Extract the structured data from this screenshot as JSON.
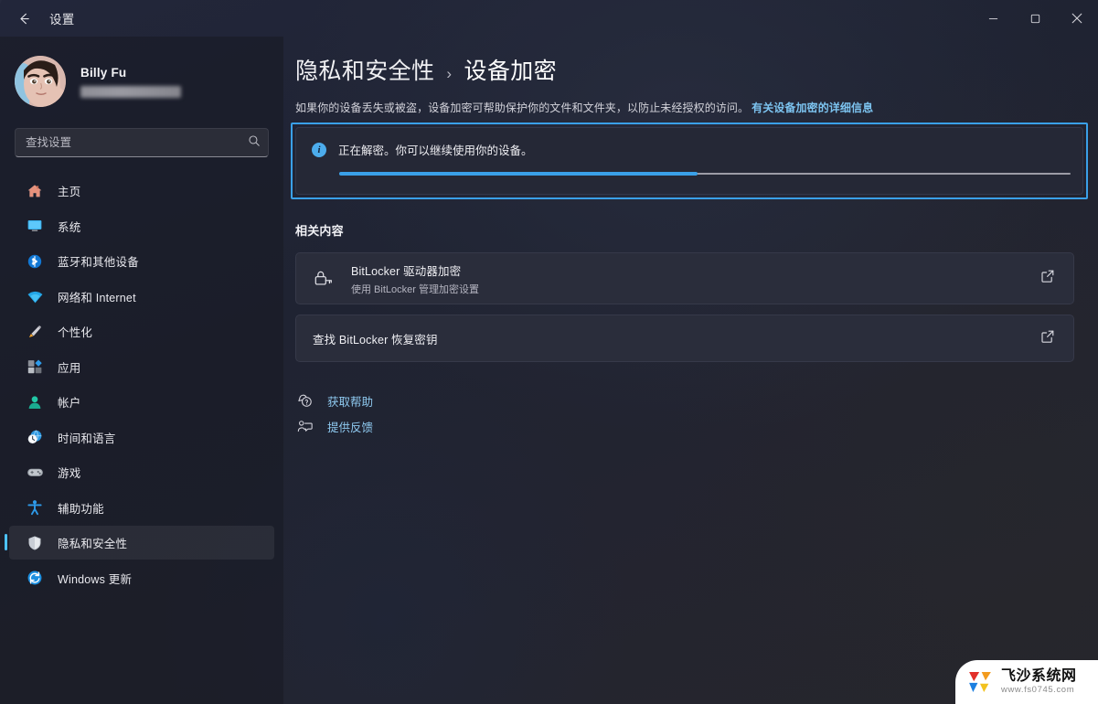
{
  "window": {
    "title": "设置",
    "back_label": "返回",
    "minimize_label": "最小化",
    "maximize_label": "最大化",
    "close_label": "关闭"
  },
  "profile": {
    "name": "Billy Fu",
    "email_redacted": ""
  },
  "search": {
    "placeholder": "查找设置",
    "value": ""
  },
  "sidebar": {
    "items": [
      {
        "label": "主页",
        "icon": "home-icon",
        "active": false
      },
      {
        "label": "系统",
        "icon": "system-icon",
        "active": false
      },
      {
        "label": "蓝牙和其他设备",
        "icon": "bluetooth-icon",
        "active": false
      },
      {
        "label": "网络和 Internet",
        "icon": "network-icon",
        "active": false
      },
      {
        "label": "个性化",
        "icon": "personalization-icon",
        "active": false
      },
      {
        "label": "应用",
        "icon": "apps-icon",
        "active": false
      },
      {
        "label": "帐户",
        "icon": "accounts-icon",
        "active": false
      },
      {
        "label": "时间和语言",
        "icon": "time-language-icon",
        "active": false
      },
      {
        "label": "游戏",
        "icon": "gaming-icon",
        "active": false
      },
      {
        "label": "辅助功能",
        "icon": "accessibility-icon",
        "active": false
      },
      {
        "label": "隐私和安全性",
        "icon": "privacy-security-icon",
        "active": true
      },
      {
        "label": "Windows 更新",
        "icon": "windows-update-icon",
        "active": false
      }
    ]
  },
  "breadcrumb": {
    "parent": "隐私和安全性",
    "separator": "›",
    "current": "设备加密"
  },
  "description": {
    "text": "如果你的设备丢失或被盗，设备加密可帮助保护你的文件和文件夹，以防止未经授权的访问。",
    "link": "有关设备加密的详细信息"
  },
  "status": {
    "message": "正在解密。你可以继续使用你的设备。",
    "icon": "info-icon",
    "info_glyph": "i",
    "progress_percent": 49,
    "highlight_color": "#3aa0e8"
  },
  "related": {
    "section_title": "相关内容",
    "cards": [
      {
        "title": "BitLocker 驱动器加密",
        "subtitle": "使用 BitLocker 管理加密设置",
        "icon": "bitlocker-lock-icon",
        "action_icon": "external-link-icon"
      },
      {
        "title": "查找 BitLocker 恢复密钥",
        "subtitle": "",
        "icon": "",
        "action_icon": "external-link-icon"
      }
    ]
  },
  "footer_links": [
    {
      "label": "获取帮助",
      "icon": "help-icon"
    },
    {
      "label": "提供反馈",
      "icon": "feedback-icon"
    }
  ],
  "watermark": {
    "name": "飞沙系统网",
    "url": "www.fs0745.com"
  }
}
